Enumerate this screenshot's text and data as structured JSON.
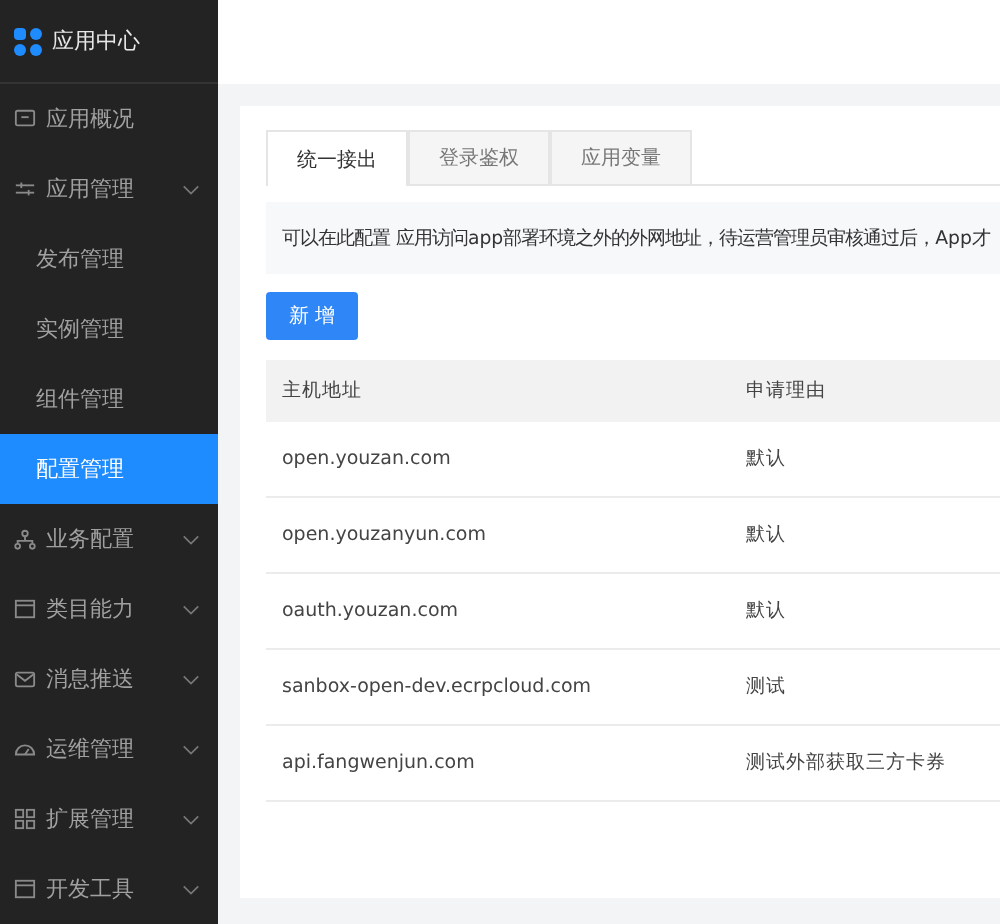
{
  "app_title": "应用中心",
  "sidebar": {
    "items": [
      {
        "label": "应用概况",
        "selected": false,
        "has_submenu": false
      },
      {
        "label": "应用管理",
        "selected": false,
        "has_submenu": true,
        "children": [
          {
            "label": "发布管理",
            "selected": false
          },
          {
            "label": "实例管理",
            "selected": false
          },
          {
            "label": "组件管理",
            "selected": false
          },
          {
            "label": "配置管理",
            "selected": true
          }
        ]
      },
      {
        "label": "业务配置",
        "selected": false,
        "has_submenu": true
      },
      {
        "label": "类目能力",
        "selected": false,
        "has_submenu": true
      },
      {
        "label": "消息推送",
        "selected": false,
        "has_submenu": true
      },
      {
        "label": "运维管理",
        "selected": false,
        "has_submenu": true
      },
      {
        "label": "扩展管理",
        "selected": false,
        "has_submenu": true
      },
      {
        "label": "开发工具",
        "selected": false,
        "has_submenu": true
      }
    ]
  },
  "tabs": [
    {
      "label": "统一接出",
      "selected": true
    },
    {
      "label": "登录鉴权",
      "selected": false
    },
    {
      "label": "应用变量",
      "selected": false
    }
  ],
  "notice": "可以在此配置 应用访问app部署环境之外的外网地址，待运营管理员审核通过后，App才",
  "add_button": "新 增",
  "table": {
    "columns": [
      "主机地址",
      "申请理由"
    ],
    "rows": [
      [
        "open.youzan.com",
        "默认"
      ],
      [
        "open.youzanyun.com",
        "默认"
      ],
      [
        "oauth.youzan.com",
        "默认"
      ],
      [
        "sanbox-open-dev.ecrpcloud.com",
        "测试"
      ],
      [
        "api.fangwenjun.com",
        "测试外部获取三方卡券"
      ]
    ]
  }
}
